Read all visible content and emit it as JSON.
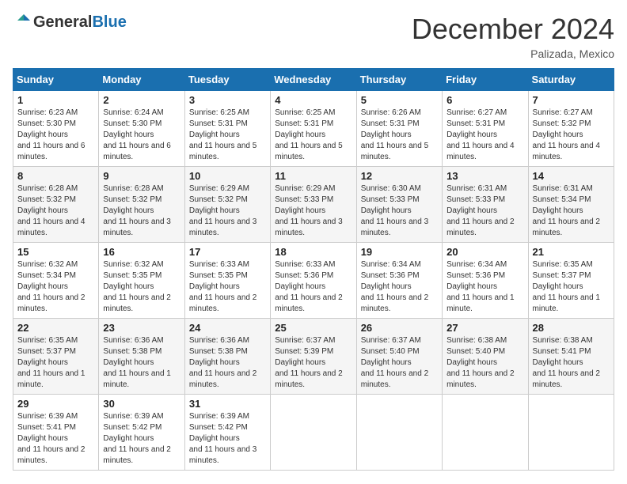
{
  "logo": {
    "general": "General",
    "blue": "Blue"
  },
  "header": {
    "month": "December 2024",
    "location": "Palizada, Mexico"
  },
  "weekdays": [
    "Sunday",
    "Monday",
    "Tuesday",
    "Wednesday",
    "Thursday",
    "Friday",
    "Saturday"
  ],
  "weeks": [
    [
      {
        "day": "1",
        "sunrise": "6:23 AM",
        "sunset": "5:30 PM",
        "daylight": "11 hours and 6 minutes."
      },
      {
        "day": "2",
        "sunrise": "6:24 AM",
        "sunset": "5:30 PM",
        "daylight": "11 hours and 6 minutes."
      },
      {
        "day": "3",
        "sunrise": "6:25 AM",
        "sunset": "5:31 PM",
        "daylight": "11 hours and 5 minutes."
      },
      {
        "day": "4",
        "sunrise": "6:25 AM",
        "sunset": "5:31 PM",
        "daylight": "11 hours and 5 minutes."
      },
      {
        "day": "5",
        "sunrise": "6:26 AM",
        "sunset": "5:31 PM",
        "daylight": "11 hours and 5 minutes."
      },
      {
        "day": "6",
        "sunrise": "6:27 AM",
        "sunset": "5:31 PM",
        "daylight": "11 hours and 4 minutes."
      },
      {
        "day": "7",
        "sunrise": "6:27 AM",
        "sunset": "5:32 PM",
        "daylight": "11 hours and 4 minutes."
      }
    ],
    [
      {
        "day": "8",
        "sunrise": "6:28 AM",
        "sunset": "5:32 PM",
        "daylight": "11 hours and 4 minutes."
      },
      {
        "day": "9",
        "sunrise": "6:28 AM",
        "sunset": "5:32 PM",
        "daylight": "11 hours and 3 minutes."
      },
      {
        "day": "10",
        "sunrise": "6:29 AM",
        "sunset": "5:32 PM",
        "daylight": "11 hours and 3 minutes."
      },
      {
        "day": "11",
        "sunrise": "6:29 AM",
        "sunset": "5:33 PM",
        "daylight": "11 hours and 3 minutes."
      },
      {
        "day": "12",
        "sunrise": "6:30 AM",
        "sunset": "5:33 PM",
        "daylight": "11 hours and 3 minutes."
      },
      {
        "day": "13",
        "sunrise": "6:31 AM",
        "sunset": "5:33 PM",
        "daylight": "11 hours and 2 minutes."
      },
      {
        "day": "14",
        "sunrise": "6:31 AM",
        "sunset": "5:34 PM",
        "daylight": "11 hours and 2 minutes."
      }
    ],
    [
      {
        "day": "15",
        "sunrise": "6:32 AM",
        "sunset": "5:34 PM",
        "daylight": "11 hours and 2 minutes."
      },
      {
        "day": "16",
        "sunrise": "6:32 AM",
        "sunset": "5:35 PM",
        "daylight": "11 hours and 2 minutes."
      },
      {
        "day": "17",
        "sunrise": "6:33 AM",
        "sunset": "5:35 PM",
        "daylight": "11 hours and 2 minutes."
      },
      {
        "day": "18",
        "sunrise": "6:33 AM",
        "sunset": "5:36 PM",
        "daylight": "11 hours and 2 minutes."
      },
      {
        "day": "19",
        "sunrise": "6:34 AM",
        "sunset": "5:36 PM",
        "daylight": "11 hours and 2 minutes."
      },
      {
        "day": "20",
        "sunrise": "6:34 AM",
        "sunset": "5:36 PM",
        "daylight": "11 hours and 1 minute."
      },
      {
        "day": "21",
        "sunrise": "6:35 AM",
        "sunset": "5:37 PM",
        "daylight": "11 hours and 1 minute."
      }
    ],
    [
      {
        "day": "22",
        "sunrise": "6:35 AM",
        "sunset": "5:37 PM",
        "daylight": "11 hours and 1 minute."
      },
      {
        "day": "23",
        "sunrise": "6:36 AM",
        "sunset": "5:38 PM",
        "daylight": "11 hours and 1 minute."
      },
      {
        "day": "24",
        "sunrise": "6:36 AM",
        "sunset": "5:38 PM",
        "daylight": "11 hours and 2 minutes."
      },
      {
        "day": "25",
        "sunrise": "6:37 AM",
        "sunset": "5:39 PM",
        "daylight": "11 hours and 2 minutes."
      },
      {
        "day": "26",
        "sunrise": "6:37 AM",
        "sunset": "5:40 PM",
        "daylight": "11 hours and 2 minutes."
      },
      {
        "day": "27",
        "sunrise": "6:38 AM",
        "sunset": "5:40 PM",
        "daylight": "11 hours and 2 minutes."
      },
      {
        "day": "28",
        "sunrise": "6:38 AM",
        "sunset": "5:41 PM",
        "daylight": "11 hours and 2 minutes."
      }
    ],
    [
      {
        "day": "29",
        "sunrise": "6:39 AM",
        "sunset": "5:41 PM",
        "daylight": "11 hours and 2 minutes."
      },
      {
        "day": "30",
        "sunrise": "6:39 AM",
        "sunset": "5:42 PM",
        "daylight": "11 hours and 2 minutes."
      },
      {
        "day": "31",
        "sunrise": "6:39 AM",
        "sunset": "5:42 PM",
        "daylight": "11 hours and 3 minutes."
      },
      null,
      null,
      null,
      null
    ]
  ]
}
